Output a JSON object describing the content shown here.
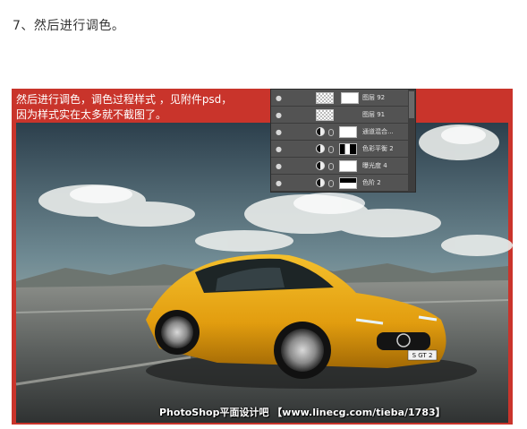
{
  "step_title": "7、然后进行调色。",
  "caption": {
    "line1": "然后进行调色，调色过程样式 ，见附件psd，",
    "line2": "因为样式实在太多就不截图了。"
  },
  "layers_panel": {
    "layers": [
      {
        "name": "图层 92",
        "type": "pixel"
      },
      {
        "name": "图层 91",
        "type": "pixel"
      },
      {
        "name": "通道混合...",
        "type": "adjustment"
      },
      {
        "name": "色彩平衡 2",
        "type": "adjustment"
      },
      {
        "name": "曝光度 4",
        "type": "adjustment"
      },
      {
        "name": "色阶 2",
        "type": "adjustment"
      }
    ]
  },
  "license_plate": "S GT 2",
  "watermark": "PhotoShop平面设计吧 【www.linecg.com/tieba/1783】",
  "colors": {
    "frame_red": "#c9342b",
    "car_yellow": "#e8a514",
    "panel_gray": "#535353"
  },
  "icons": [
    "eye-icon",
    "adjustment-icon",
    "link-icon"
  ]
}
